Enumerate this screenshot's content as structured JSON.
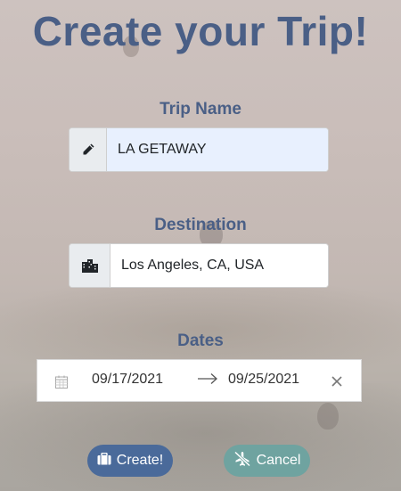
{
  "page": {
    "title": "Create your Trip!"
  },
  "trip_name": {
    "label": "Trip Name",
    "value": "LA GETAWAY",
    "icon": "pencil-icon"
  },
  "destination": {
    "label": "Destination",
    "value": "Los Angeles, CA, USA",
    "icon": "city-icon"
  },
  "dates": {
    "label": "Dates",
    "start": "09/17/2021",
    "end": "09/25/2021",
    "icons": [
      "calendar-icon",
      "arrow-right-icon",
      "close-icon"
    ]
  },
  "actions": {
    "create_label": "Create!",
    "cancel_label": "Cancel",
    "create_color": "#4a6a9a",
    "cancel_color": "#6fa3a0"
  }
}
